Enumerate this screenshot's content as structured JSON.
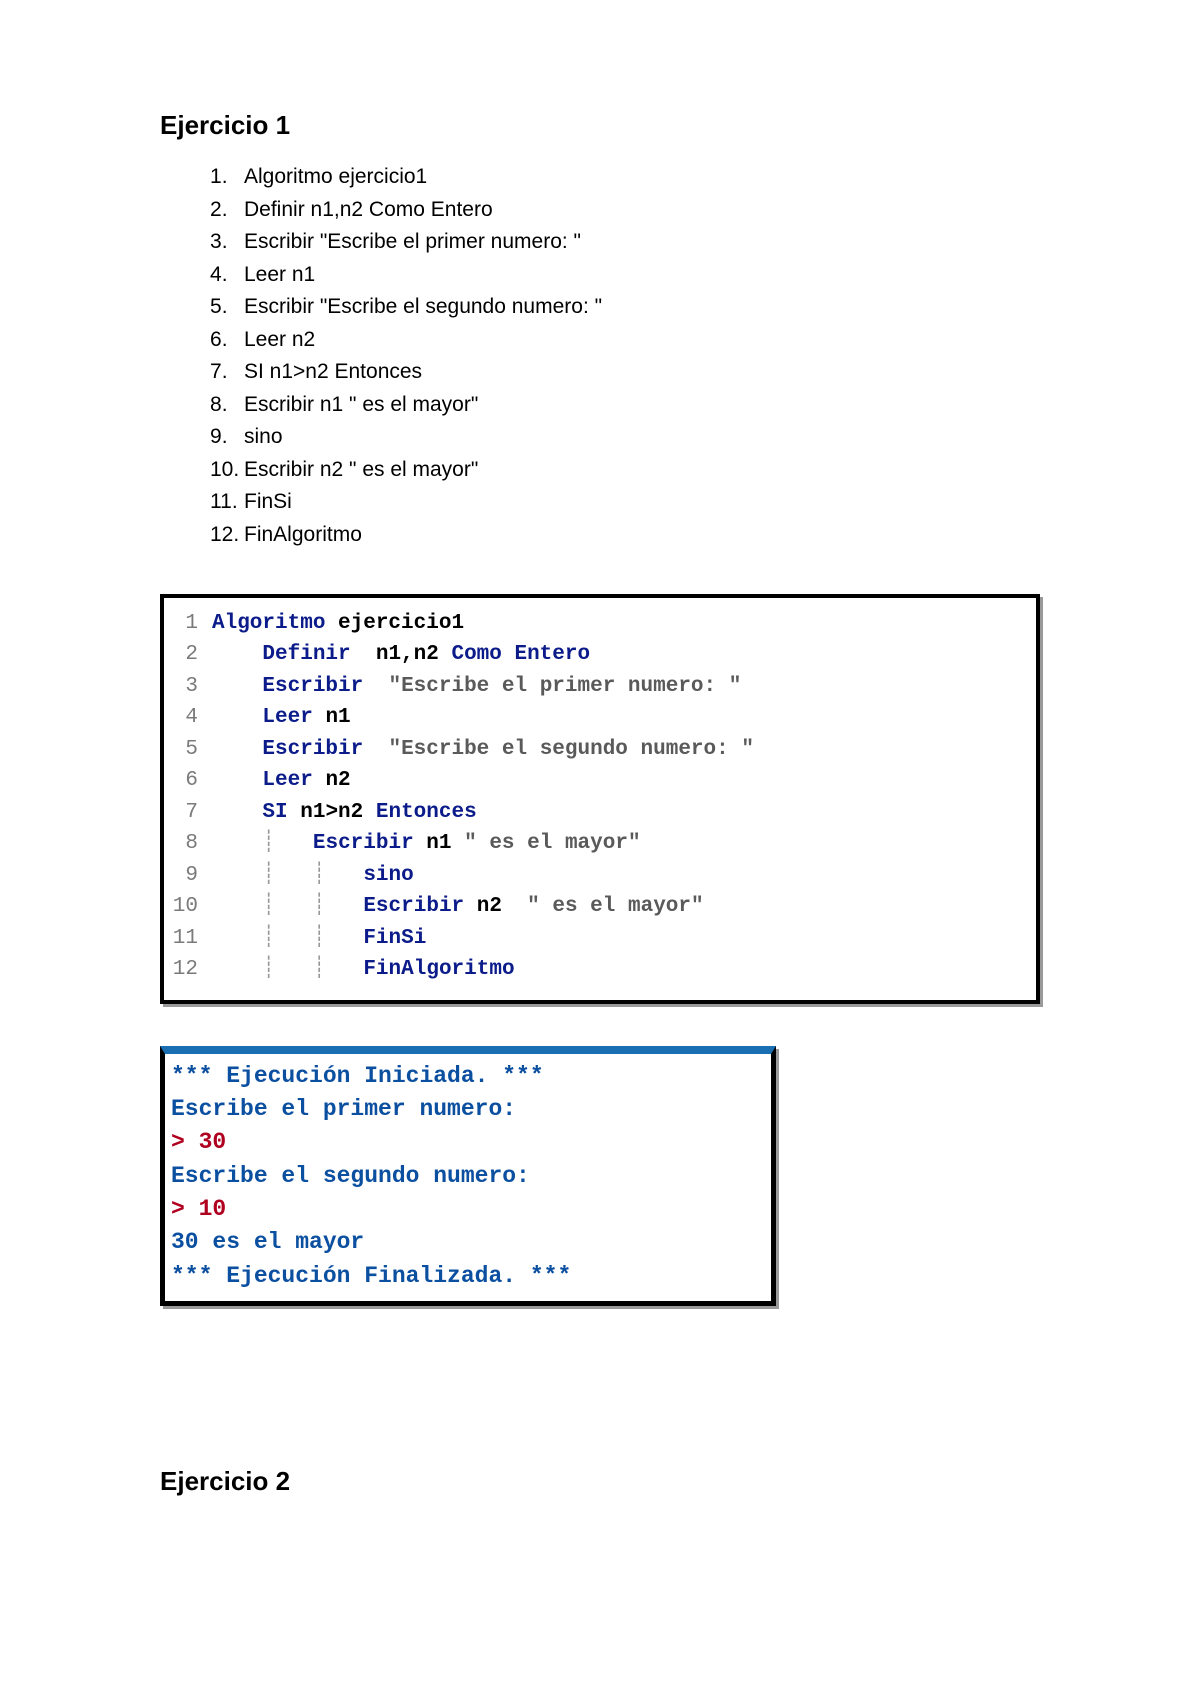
{
  "exercise1": {
    "title": "Ejercicio 1",
    "steps": [
      "Algoritmo ejercicio1",
      "Definir  n1,n2 Como Entero",
      "Escribir  \"Escribe el primer numero: \"",
      "Leer n1",
      "Escribir  \"Escribe el segundo numero: \"",
      "Leer n2",
      "SI n1>n2 Entonces",
      "Escribir n1 \" es el mayor\"",
      "sino",
      "Escribir n2  \" es el mayor\"",
      "FinSi",
      "FinAlgoritmo"
    ]
  },
  "code": {
    "lines": [
      {
        "n": "1",
        "indent": "",
        "kw": "Algoritmo",
        "rest": " ejercicio1"
      },
      {
        "n": "2",
        "indent": "    ",
        "kw": "Definir",
        "rest": "  n1,n2 ",
        "kw2": "Como Entero"
      },
      {
        "n": "3",
        "indent": "    ",
        "kw": "Escribir",
        "rest": "  ",
        "str": "\"Escribe el primer numero: \""
      },
      {
        "n": "4",
        "indent": "    ",
        "kw": "Leer",
        "rest": " n1"
      },
      {
        "n": "5",
        "indent": "    ",
        "kw": "Escribir",
        "rest": "  ",
        "str": "\"Escribe el segundo numero: \""
      },
      {
        "n": "6",
        "indent": "    ",
        "kw": "Leer",
        "rest": " n2"
      },
      {
        "n": "7",
        "indent": "    ",
        "kw": "SI",
        "mid": " n1>n2 ",
        "kw2": "Entonces"
      },
      {
        "n": "8",
        "indent": "    ",
        "bar": "┊   ",
        "kw": "Escribir",
        "mid": " n1 ",
        "str": "\" es el mayor\""
      },
      {
        "n": "9",
        "indent": "    ",
        "bar": "┊   ┊   ",
        "kw": "sino"
      },
      {
        "n": "10",
        "indent": "    ",
        "bar": "┊   ┊   ",
        "kw": "Escribir",
        "mid": " n2  ",
        "str": "\" es el mayor\""
      },
      {
        "n": "11",
        "indent": "    ",
        "bar": "┊   ┊   ",
        "kw": "FinSi"
      },
      {
        "n": "12",
        "indent": "    ",
        "bar": "┊   ┊   ",
        "kw": "FinAlgoritmo"
      }
    ]
  },
  "console": {
    "line1": "*** Ejecución Iniciada. ***",
    "line2": "Escribe el primer numero: ",
    "line3": "> 30",
    "line4": "Escribe el segundo numero: ",
    "line5": "> 10",
    "line6": "30 es el mayor",
    "line7": "*** Ejecución Finalizada. ***"
  },
  "exercise2": {
    "title": "Ejercicio 2"
  }
}
